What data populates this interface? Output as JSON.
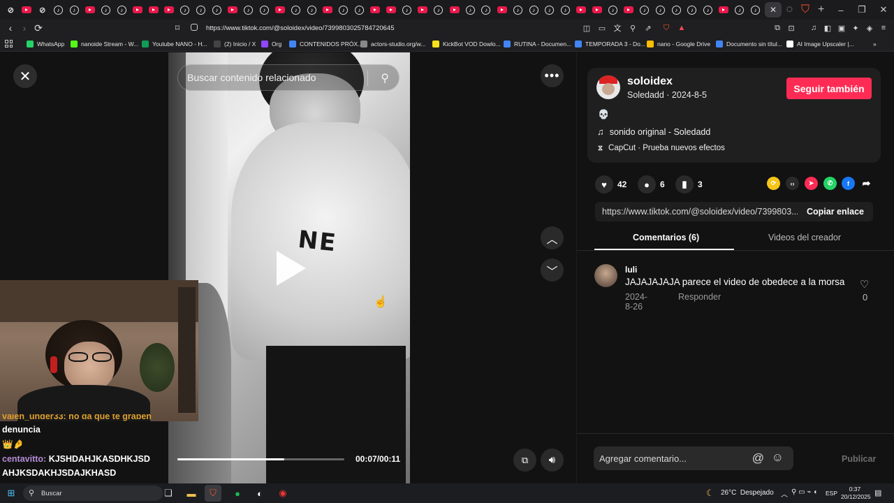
{
  "browser": {
    "url": "https://www.tiktok.com/@soloidex/video/7399803025784720645",
    "bookmarks": [
      {
        "label": "WhatsApp",
        "color": "#25d366"
      },
      {
        "label": "nanoide Stream - W...",
        "color": "#53fc18"
      },
      {
        "label": "Youtube NANO - H...",
        "color": "#0f9d58"
      },
      {
        "label": "(2) Inicio / X",
        "color": "#444444"
      },
      {
        "label": "Org",
        "color": "#9146ff"
      },
      {
        "label": "CONTENIDOS PRÓX...",
        "color": "#4285f4"
      },
      {
        "label": "actors-studio.org/w...",
        "color": "#888888"
      },
      {
        "label": "KickBot VOD Dowlo...",
        "color": "#f7e11b"
      },
      {
        "label": "RUTINA - Documen...",
        "color": "#4285f4"
      },
      {
        "label": "TEMPORADA 3 - Do...",
        "color": "#4285f4"
      },
      {
        "label": "nano - Google Drive",
        "color": "#fbbc04"
      },
      {
        "label": "Documento sin títul...",
        "color": "#4285f4"
      },
      {
        "label": "AI Image Upscaler |...",
        "color": "#ffffff"
      }
    ]
  },
  "video": {
    "search_placeholder": "Buscar contenido relacionado",
    "time": "00:07/00:11",
    "progress": 0.64
  },
  "stream_chat": {
    "partial_line": "valen_under33: no da que te graben",
    "line1_cont": "denuncia",
    "line2_emotes": "👑🤌",
    "user3": "centavitto:",
    "msg3a": "KJSHDAHJKASDHKJSD",
    "msg3b": "AHJKSDAKHJSDAJKHASD"
  },
  "post": {
    "username": "soloidex",
    "subtitle": "Soledadd · 2024-8-5",
    "follow_label": "Seguir también",
    "caption_emoji": "💀",
    "sound": "sonido original - Soledadd",
    "capcut": "CapCut · Prueba nuevos efectos",
    "likes": "42",
    "comments": "6",
    "saves": "3",
    "link": "https://www.tiktok.com/@soloidex/video/7399803...",
    "copy_label": "Copiar enlace",
    "tab_comments": "Comentarios (6)",
    "tab_videos": "Videos del creador"
  },
  "comment": {
    "author": "luli",
    "text": "JAJAJAJAJA parece el video de obedece a la morsa",
    "date": "2024-8-26",
    "reply_label": "Responder",
    "likes": "0"
  },
  "compose": {
    "placeholder": "Agregar comentario...",
    "publish_label": "Publicar"
  },
  "taskbar": {
    "search_label": "Buscar",
    "weather": "26°C  Despejado",
    "lang": "ESP",
    "time": "0:37",
    "date": "20/12/2025"
  }
}
